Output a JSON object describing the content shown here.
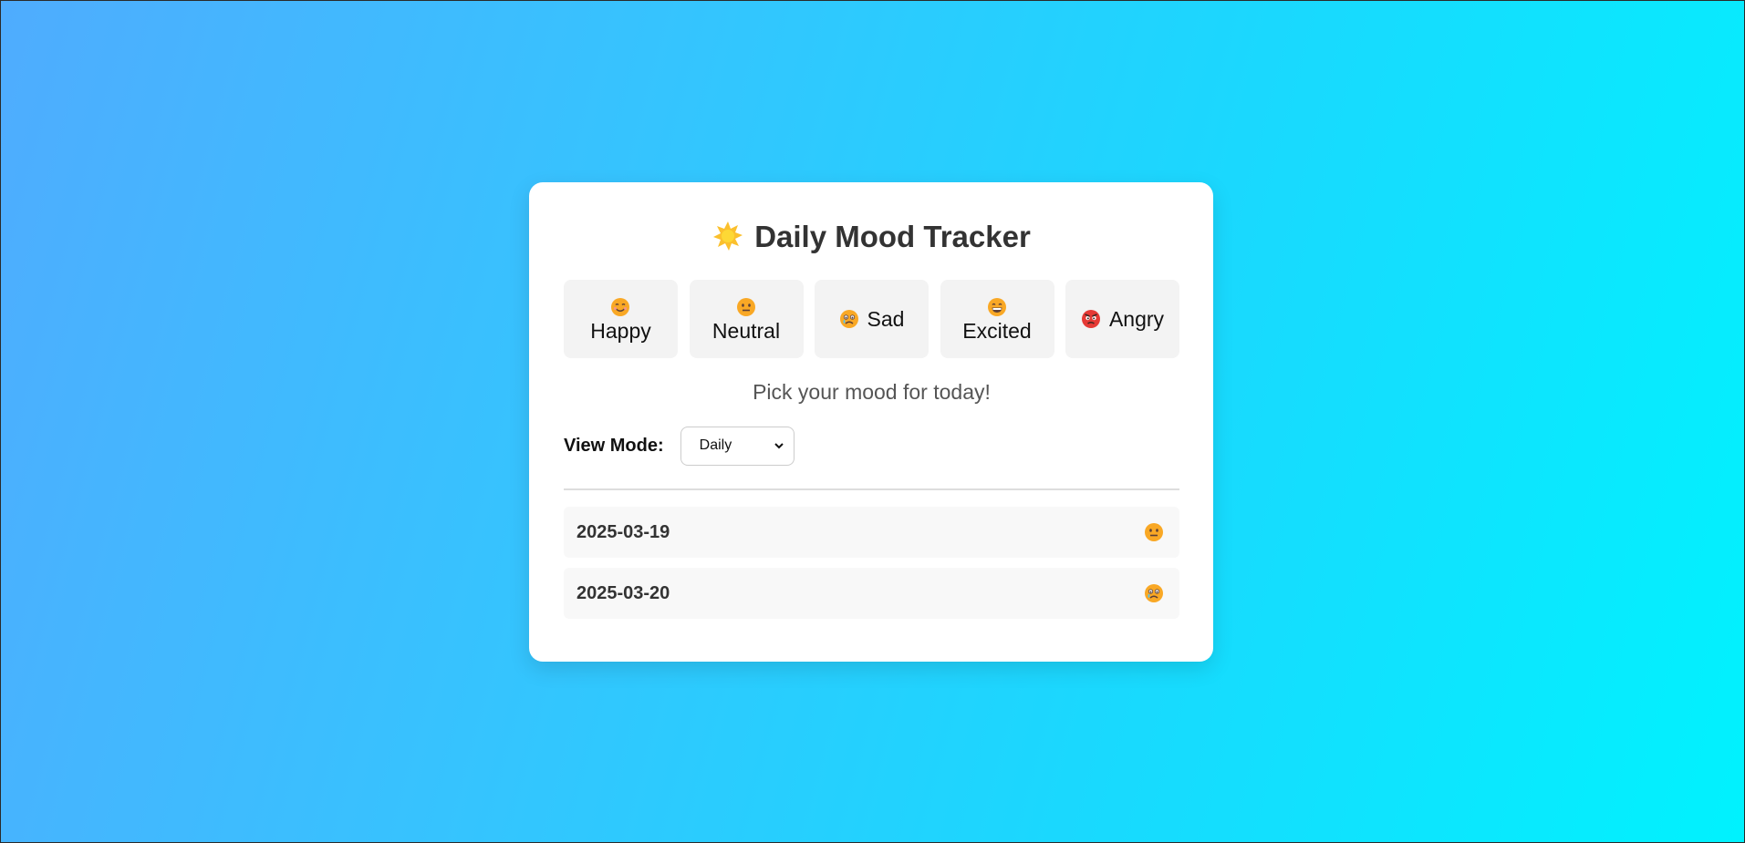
{
  "title": {
    "icon": "sun-icon",
    "text": "Daily Mood Tracker"
  },
  "moods": [
    {
      "id": "happy",
      "label": "Happy",
      "icon": "smiling-face-icon"
    },
    {
      "id": "neutral",
      "label": "Neutral",
      "icon": "neutral-face-icon"
    },
    {
      "id": "sad",
      "label": "Sad",
      "icon": "sad-face-icon"
    },
    {
      "id": "excited",
      "label": "Excited",
      "icon": "grinning-face-icon"
    },
    {
      "id": "angry",
      "label": "Angry",
      "icon": "angry-face-icon"
    }
  ],
  "prompt": "Pick your mood for today!",
  "view_mode": {
    "label": "View Mode:",
    "selected": "Daily"
  },
  "entries": [
    {
      "date": "2025-03-19",
      "mood_icon": "neutral-face-icon"
    },
    {
      "date": "2025-03-20",
      "mood_icon": "sad-face-icon"
    }
  ],
  "colors": {
    "gradient_start": "#4facfe",
    "gradient_end": "#00f2fe",
    "card_bg": "#ffffff",
    "mood_button_bg": "#f3f3f3",
    "entry_bg": "#f8f8f8",
    "emoji_yellow": "#f9a825",
    "angry_red": "#e53935"
  }
}
